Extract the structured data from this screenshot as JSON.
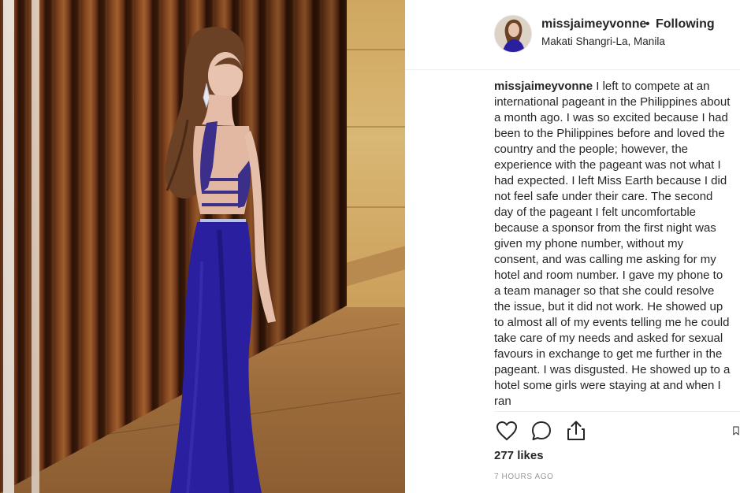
{
  "post": {
    "photo_alt": "",
    "header": {
      "username": "missjaimeyvonne",
      "separator": "•",
      "follow_status": "Following",
      "location": "Makati Shangri-La, Manila"
    },
    "caption": {
      "username": "missjaimeyvonne",
      "text": "I left to compete at an international pageant in the Philippines about a month ago. I was so excited because I had been to the Philippines before and loved the country and the people; however, the experience with the pageant was not what I had expected. I left Miss Earth because I did not feel safe under their care. The second day of the pageant I felt uncomfortable because a sponsor from the first night was given my phone number, without my consent, and was calling me asking for my hotel and room number. I gave my phone to a team manager so that she could resolve the issue, but it did not work. He showed up to almost all of my events telling me he could take care of my needs and asked for sexual favours in exchange to get me further in the pageant. I was disgusted. He showed up to a hotel some girls were staying at and when I ran"
    },
    "actions": {
      "like_icon": "heart-outline-icon",
      "comment_icon": "comment-bubble-icon",
      "share_icon": "share-arrow-icon",
      "save_icon": "bookmark-icon"
    },
    "likes": "277 likes",
    "timestamp": "7 HOURS AGO"
  },
  "colors": {
    "text": "#262626",
    "muted": "#999999",
    "border": "#efefef",
    "dress": "#2a1f9e"
  }
}
